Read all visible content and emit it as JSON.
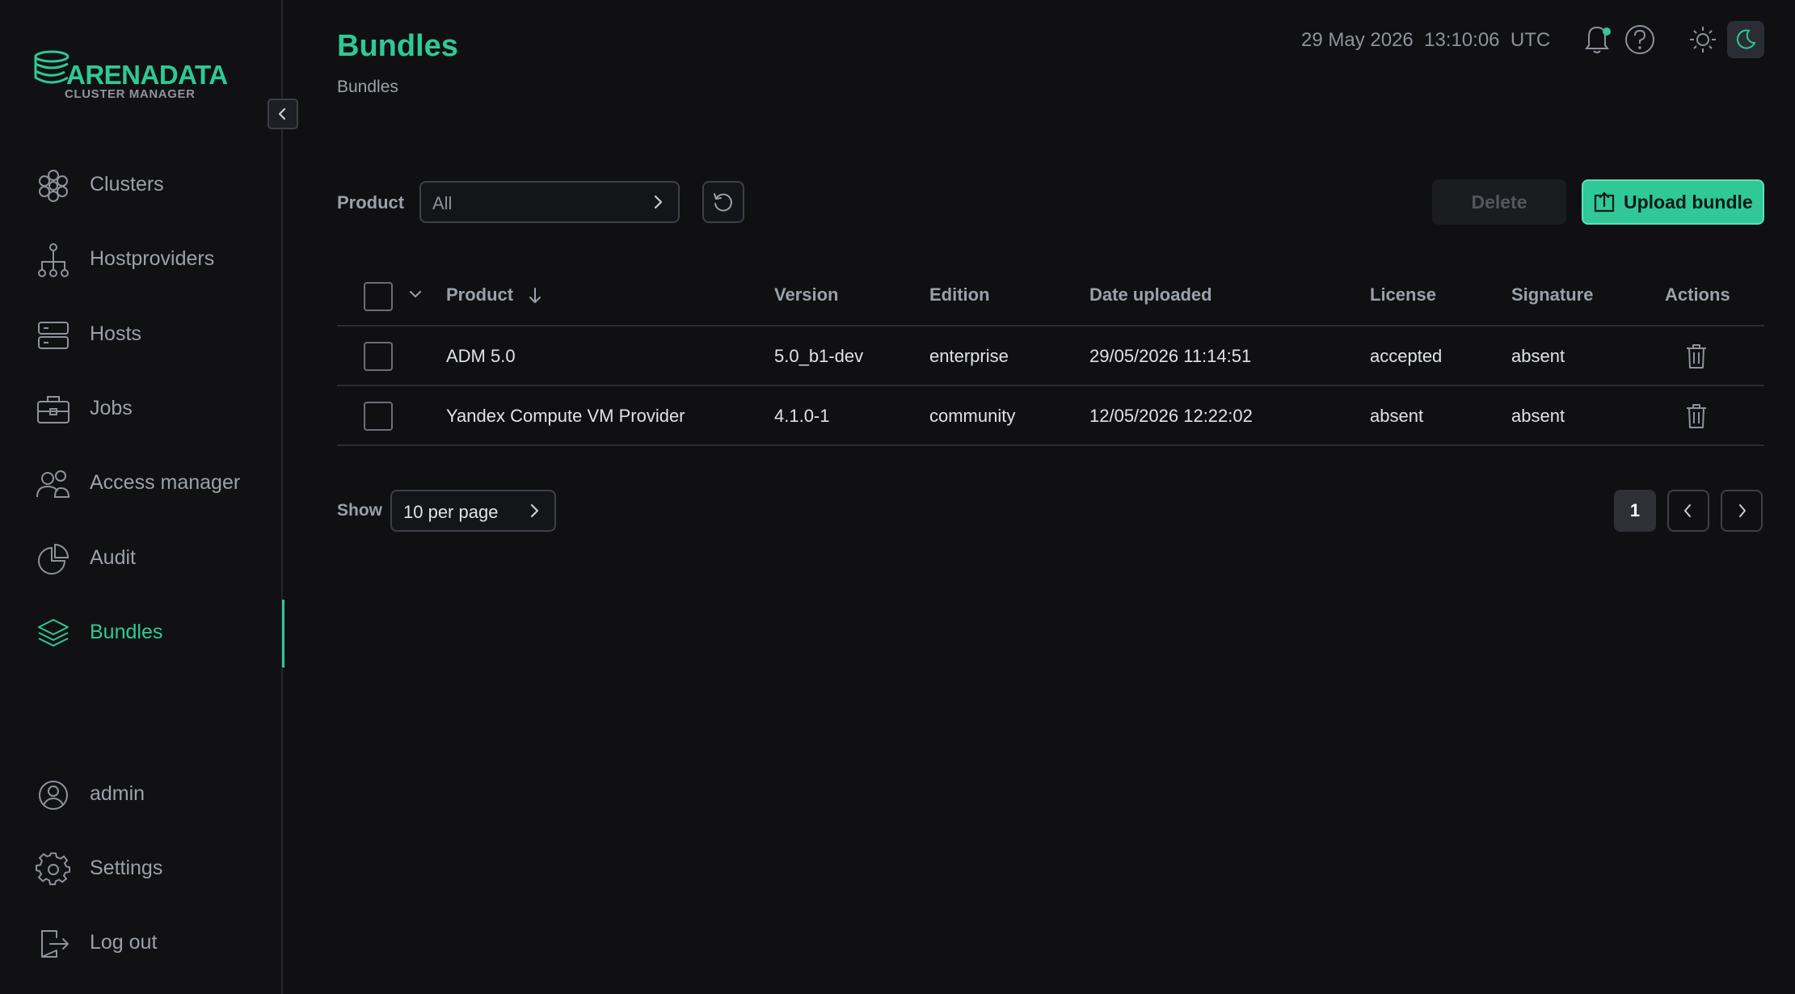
{
  "app": {
    "logo_text": "ARENADATA",
    "logo_subtitle": "CLUSTER MANAGER",
    "accent_color": "#2fc896"
  },
  "sidebar": {
    "items": [
      {
        "label": "Clusters",
        "icon": "clusters-icon"
      },
      {
        "label": "Hostproviders",
        "icon": "hostproviders-icon"
      },
      {
        "label": "Hosts",
        "icon": "hosts-icon"
      },
      {
        "label": "Jobs",
        "icon": "jobs-icon"
      },
      {
        "label": "Access manager",
        "icon": "access-manager-icon"
      },
      {
        "label": "Audit",
        "icon": "audit-icon"
      },
      {
        "label": "Bundles",
        "icon": "bundles-icon",
        "active": true
      }
    ],
    "bottom_items": [
      {
        "label": "admin",
        "icon": "user-icon"
      },
      {
        "label": "Settings",
        "icon": "settings-icon"
      },
      {
        "label": "Log out",
        "icon": "logout-icon"
      }
    ]
  },
  "header": {
    "title": "Bundles",
    "breadcrumb": "Bundles",
    "datetime": "29 May 2026  13:10:06  UTC"
  },
  "toolbar": {
    "product_label": "Product",
    "product_value": "All",
    "delete_label": "Delete",
    "upload_label": "Upload bundle"
  },
  "table": {
    "columns": [
      "Product",
      "Version",
      "Edition",
      "Date uploaded",
      "License",
      "Signature",
      "Actions"
    ],
    "rows": [
      {
        "product": "ADM 5.0",
        "version": "5.0_b1-dev",
        "edition": "enterprise",
        "date": "29/05/2026 11:14:51",
        "license": "accepted",
        "signature": "absent"
      },
      {
        "product": "Yandex Compute VM Provider",
        "version": "4.1.0-1",
        "edition": "community",
        "date": "12/05/2026 12:22:02",
        "license": "absent",
        "signature": "absent"
      }
    ]
  },
  "pagination": {
    "show_label": "Show",
    "per_page": "10 per page",
    "current_page": "1"
  }
}
